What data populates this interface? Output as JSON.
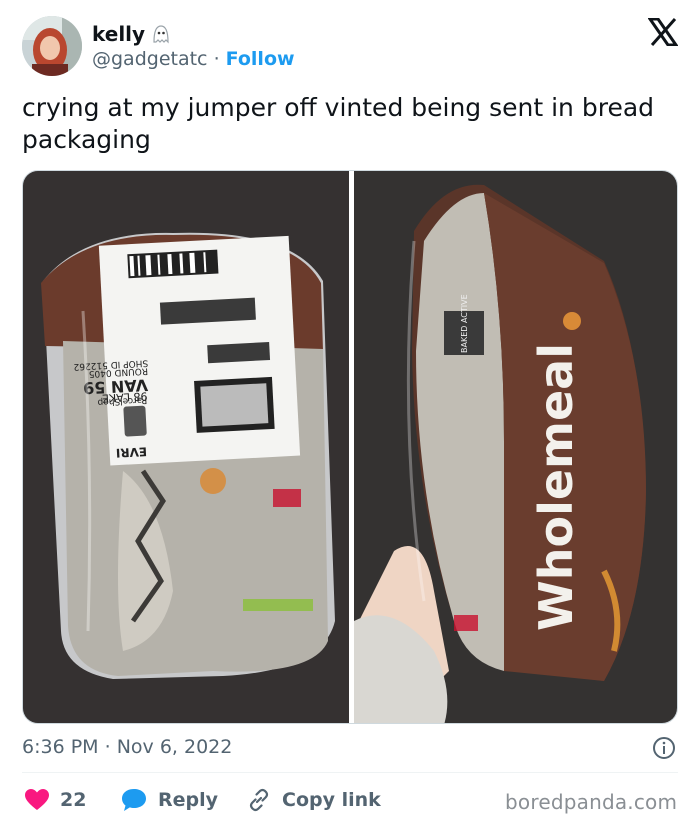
{
  "author": {
    "name": "kelly",
    "handle": "@gadgetatc",
    "separator": "·",
    "follow_label": "Follow"
  },
  "tweet": {
    "text": "crying at my jumper off vinted being sent in bread packaging"
  },
  "media": {
    "left_label_lines": [
      "SHOP ID 512262",
      "ROUND 0405",
      "VAN 59",
      "98 LAKE",
      "ParcelShop",
      "EVRI"
    ],
    "right_brand": "Wholemeal",
    "right_badge": "BAKED ACTIVE"
  },
  "meta": {
    "time": "6:36 PM",
    "separator": "·",
    "date": "Nov 6, 2022"
  },
  "actions": {
    "like_count": "22",
    "reply_label": "Reply",
    "copy_label": "Copy link"
  },
  "watermark": "boredpanda.com",
  "colors": {
    "accent": "#1d9bf0",
    "like": "#f91880",
    "muted": "#536471"
  }
}
